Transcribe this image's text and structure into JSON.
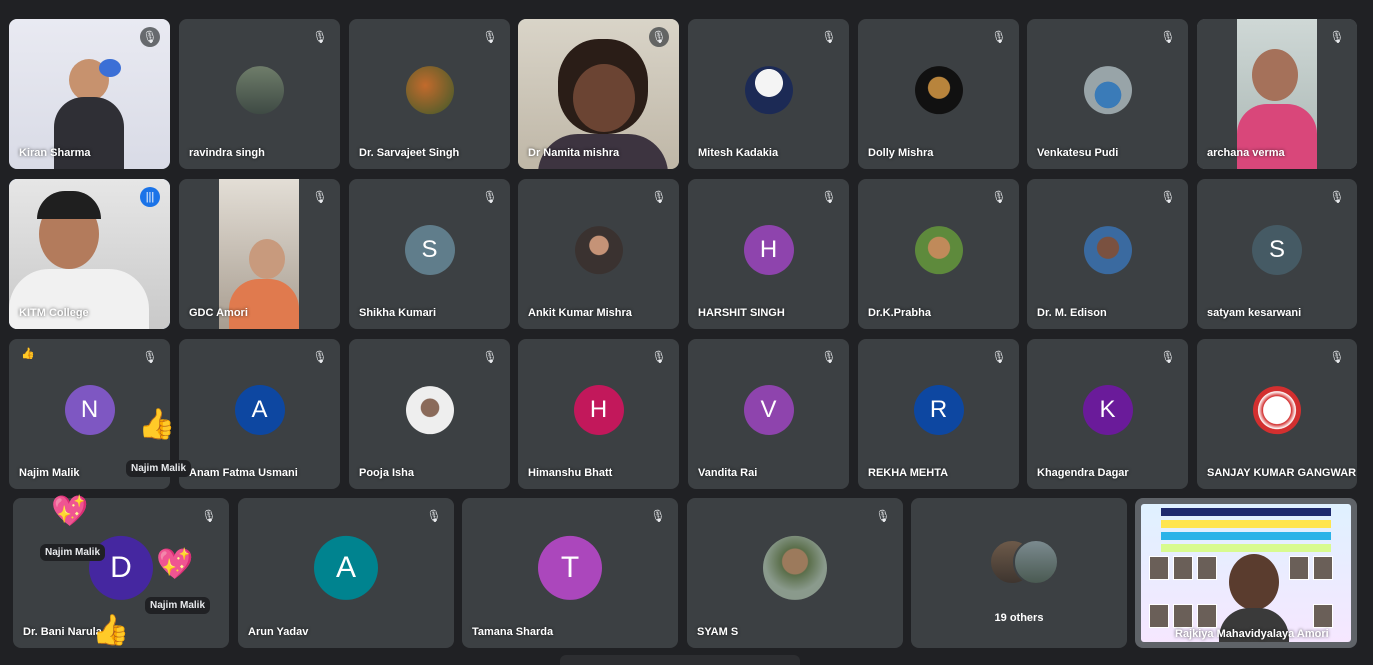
{
  "tiles_row1": [
    {
      "name": "Kiran Sharma",
      "mic": "muted"
    },
    {
      "name": "ravindra singh",
      "mic": "muted"
    },
    {
      "name": "Dr. Sarvajeet Singh",
      "mic": "muted"
    },
    {
      "name": "Dr Namita mishra",
      "mic": "muted"
    },
    {
      "name": "Mitesh Kadakia",
      "mic": "muted"
    },
    {
      "name": "Dolly Mishra",
      "mic": "muted"
    },
    {
      "name": "Venkatesu Pudi",
      "mic": "muted"
    },
    {
      "name": "archana verma",
      "mic": "muted"
    }
  ],
  "tiles_row2": [
    {
      "name": "KITM College",
      "mic": "speaking"
    },
    {
      "name": "GDC Amori",
      "mic": "muted"
    },
    {
      "name": "Shikha Kumari",
      "initial": "S",
      "color": "#607d8b",
      "mic": "muted"
    },
    {
      "name": "Ankit Kumar Mishra",
      "mic": "muted"
    },
    {
      "name": "HARSHIT SINGH",
      "initial": "H",
      "color": "#8e44ad",
      "mic": "muted"
    },
    {
      "name": "Dr.K.Prabha",
      "mic": "muted"
    },
    {
      "name": "Dr. M. Edison",
      "mic": "muted"
    },
    {
      "name": "satyam kesarwani",
      "initial": "S",
      "color": "#455a64",
      "mic": "muted"
    }
  ],
  "tiles_row3": [
    {
      "name": "Najim Malik",
      "initial": "N",
      "color": "#7e57c2",
      "mic": "muted"
    },
    {
      "name": "Anam Fatma Usmani",
      "initial": "A",
      "color": "#0d47a1",
      "mic": "muted"
    },
    {
      "name": "Pooja Isha",
      "mic": "muted"
    },
    {
      "name": "Himanshu Bhatt",
      "initial": "H",
      "color": "#c2185b",
      "mic": "muted"
    },
    {
      "name": "Vandita Rai",
      "initial": "V",
      "color": "#8e44ad",
      "mic": "muted"
    },
    {
      "name": "REKHA MEHTA",
      "initial": "R",
      "color": "#0d47a1",
      "mic": "muted"
    },
    {
      "name": "Khagendra Dagar",
      "initial": "K",
      "color": "#6a1b9a",
      "mic": "muted"
    },
    {
      "name": "SANJAY KUMAR GANGWAR",
      "mic": "muted"
    }
  ],
  "tiles_row4": [
    {
      "name": "Dr. Bani Narula",
      "initial": "D",
      "color": "#4527a0",
      "mic": "muted"
    },
    {
      "name": "Arun Yadav",
      "initial": "A",
      "color": "#00838f",
      "mic": "muted"
    },
    {
      "name": "Tamana Sharda",
      "initial": "T",
      "color": "#ab47bc",
      "mic": "muted"
    },
    {
      "name": "SYAM S",
      "mic": "muted"
    },
    {
      "name": "19 others"
    },
    {
      "name": "Rajkiya Mahavidyalaya Amori"
    }
  ],
  "reactions": {
    "sender": "Najim Malik",
    "thumbs_up": "👍",
    "heart": "💖",
    "raised_hand": "👍"
  },
  "icons": {
    "muted": "mic-off-icon",
    "speaking": "audio-level-icon"
  }
}
